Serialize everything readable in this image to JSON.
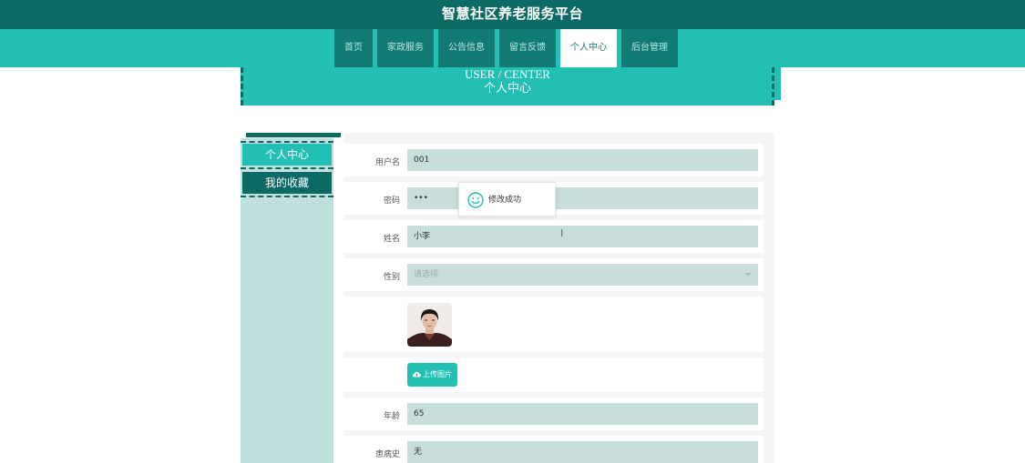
{
  "header": {
    "title": "智慧社区养老服务平台"
  },
  "nav": {
    "items": [
      "首页",
      "家政服务",
      "公告信息",
      "留言反馈",
      "个人中心",
      "后台管理"
    ],
    "active_index": 4
  },
  "banner": {
    "title_en": "USER / CENTER",
    "title_cn": "个人中心"
  },
  "sidebar": {
    "items": [
      "个人中心",
      "我的收藏"
    ]
  },
  "form": {
    "username": {
      "label": "用户名",
      "value": "001"
    },
    "password": {
      "label": "密码",
      "value": "•••"
    },
    "name": {
      "label": "姓名",
      "value": "小李"
    },
    "gender": {
      "label": "性别",
      "placeholder": "请选择"
    },
    "upload_label": "上传图片",
    "age": {
      "label": "年龄",
      "value": "65"
    },
    "medical_history": {
      "label": "患病史",
      "value": "无"
    }
  },
  "toast": {
    "message": "修改成功"
  },
  "colors": {
    "dark_teal": "#0b6a64",
    "teal": "#24bfb4",
    "field_bg": "#c9dedb",
    "sidebar_bg": "#bfe0dc"
  }
}
